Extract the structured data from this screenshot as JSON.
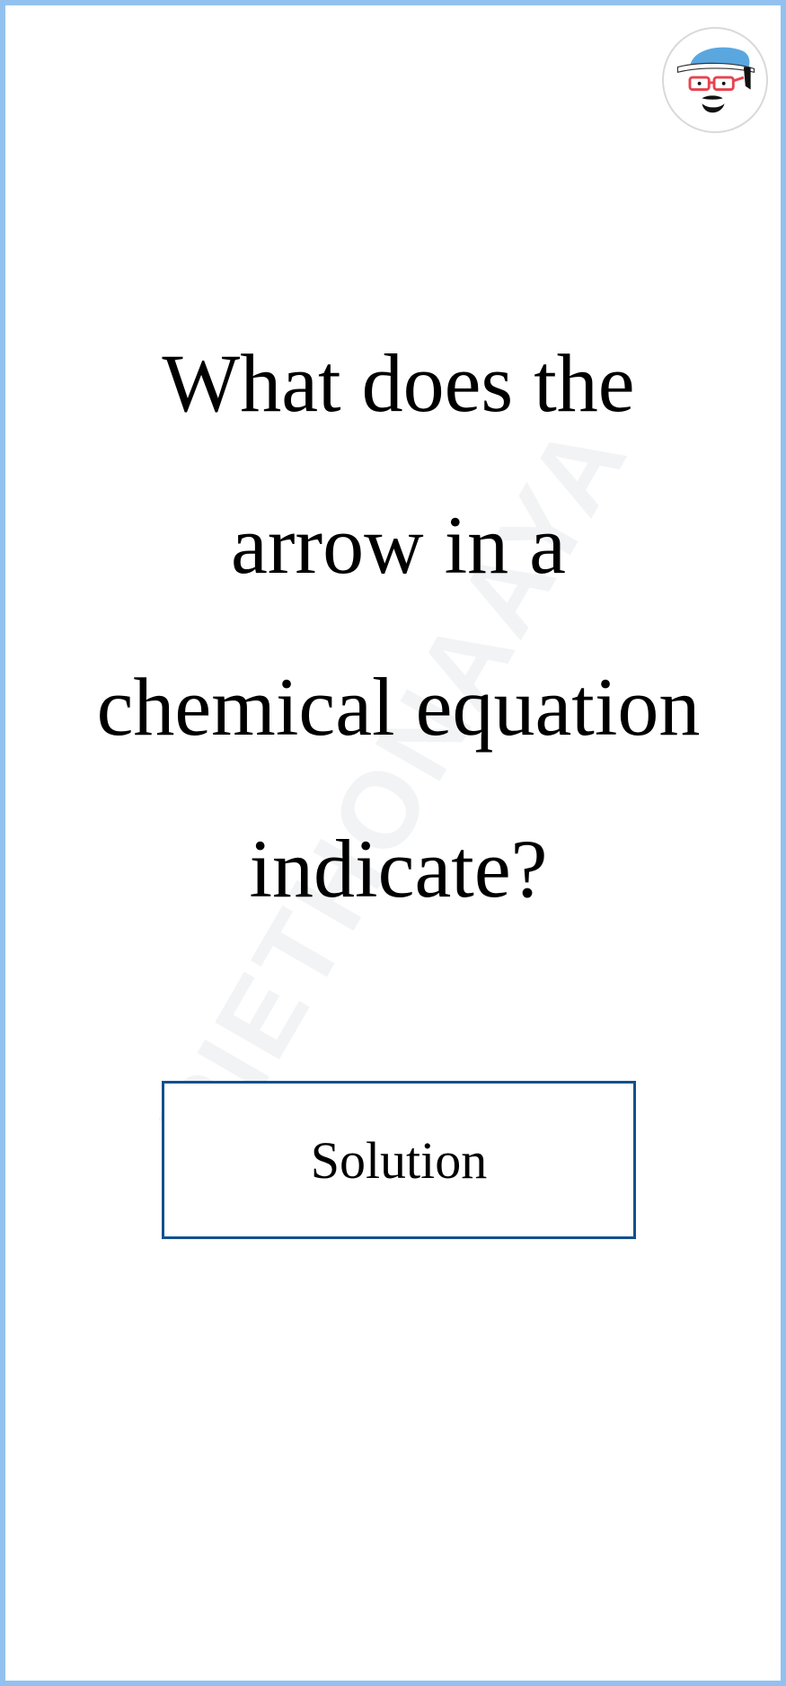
{
  "question": {
    "lines": [
      "What does the",
      "arrow in a",
      "chemical equation",
      "indicate?"
    ]
  },
  "solution_button": {
    "label": "Solution"
  },
  "avatar": {
    "icon": "cartoon-face-icon"
  },
  "watermark": {
    "text": "PIETHONAAYA"
  },
  "colors": {
    "frame_border": "#93c1ef",
    "button_border": "#13508f",
    "text": "#000000",
    "background": "#ffffff"
  }
}
